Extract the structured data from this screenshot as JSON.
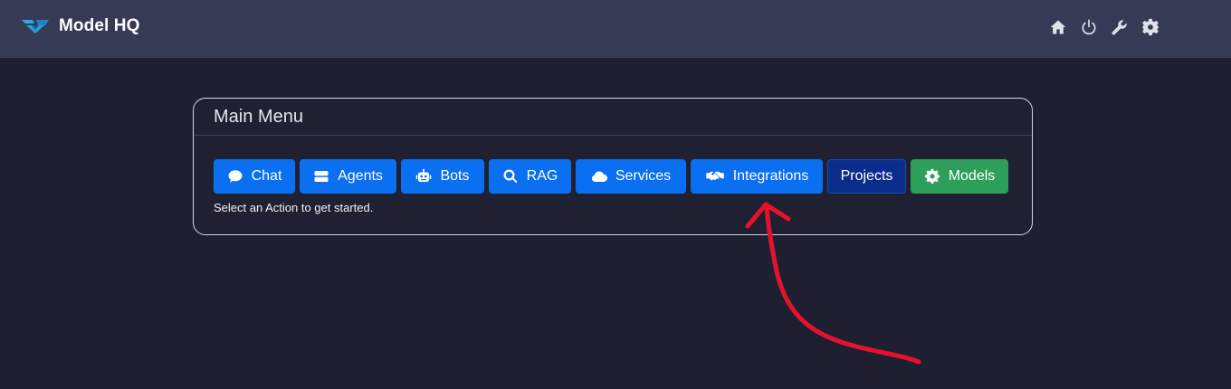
{
  "app": {
    "title": "Model HQ",
    "logo_icon": "model-hq-logo-icon"
  },
  "nav": {
    "icons": [
      "home-icon",
      "power-icon",
      "wrench-icon",
      "gear-icon"
    ]
  },
  "main_menu": {
    "title": "Main Menu",
    "hint": "Select an Action to get started.",
    "buttons": [
      {
        "label": "Chat",
        "icon": "chat-bubble-icon",
        "color": "#0a6ff0"
      },
      {
        "label": "Agents",
        "icon": "server-icon",
        "color": "#0a6ff0"
      },
      {
        "label": "Bots",
        "icon": "robot-icon",
        "color": "#0a6ff0"
      },
      {
        "label": "RAG",
        "icon": "search-icon",
        "color": "#0a6ff0"
      },
      {
        "label": "Services",
        "icon": "cloud-icon",
        "color": "#0a6ff0"
      },
      {
        "label": "Integrations",
        "icon": "handshake-icon",
        "color": "#0a6ff0"
      },
      {
        "label": "Projects",
        "icon": "",
        "color": "#0a2d8c"
      },
      {
        "label": "Models",
        "icon": "gear-hex-icon",
        "color": "#2e9e5b"
      }
    ]
  },
  "annotation": {
    "type": "red-arrow",
    "color": "#e8112d",
    "points_to": "Integrations"
  }
}
